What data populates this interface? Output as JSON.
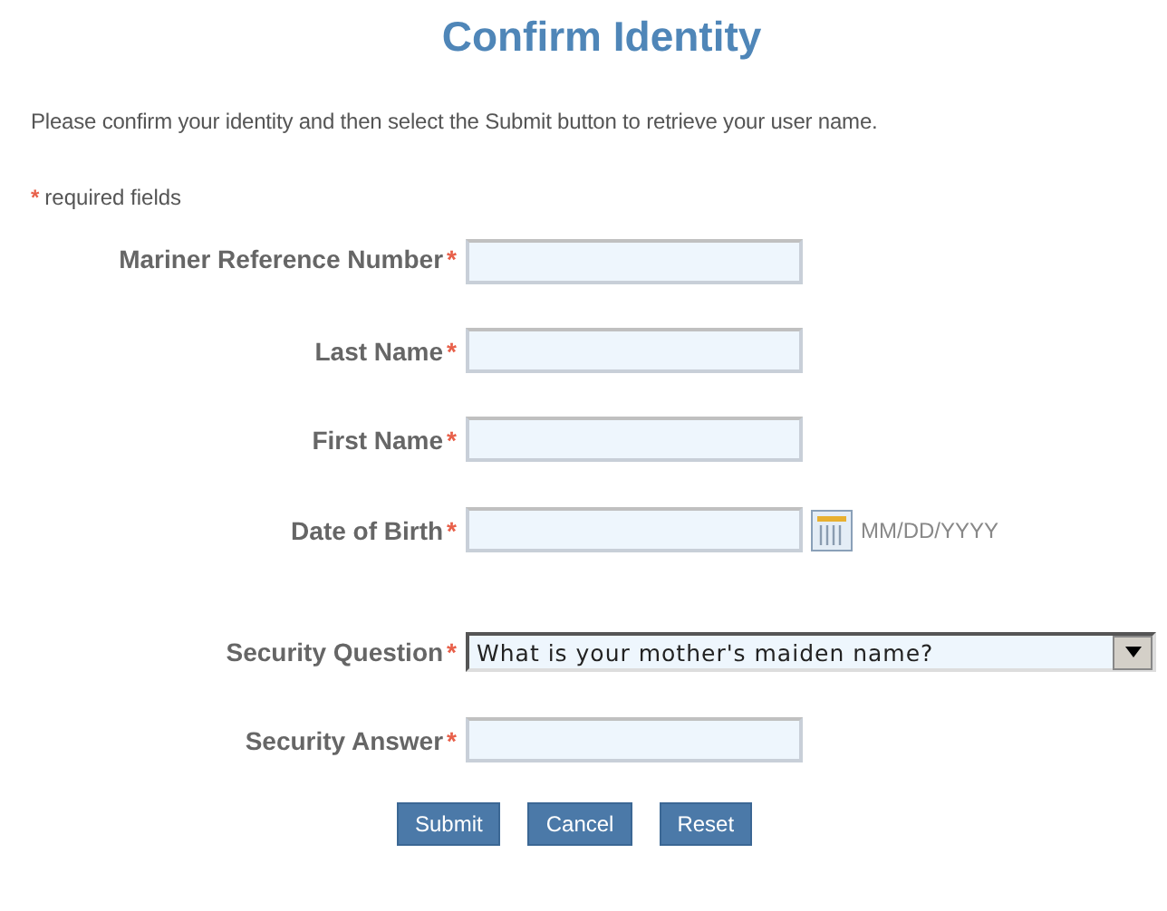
{
  "title": "Confirm Identity",
  "intro": "Please confirm your identity and then select the Submit button to retrieve your user name.",
  "legend": {
    "mark": "*",
    "text": "required fields"
  },
  "fields": [
    {
      "kind": "text",
      "label": "Mariner Reference Number",
      "mark": "*"
    },
    {
      "kind": "text",
      "label": "Last Name",
      "mark": "*"
    },
    {
      "kind": "text",
      "label": "First Name",
      "mark": "*"
    },
    {
      "kind": "date",
      "label": "Date of Birth",
      "mark": "*",
      "hint": "MM/DD/YYYY"
    },
    {
      "kind": "select",
      "label": "Security Question",
      "mark": "*",
      "value": "What is your mother's maiden name?"
    },
    {
      "kind": "text",
      "label": "Security Answer",
      "mark": "*"
    }
  ],
  "buttons": [
    "Submit",
    "Cancel",
    "Reset"
  ]
}
